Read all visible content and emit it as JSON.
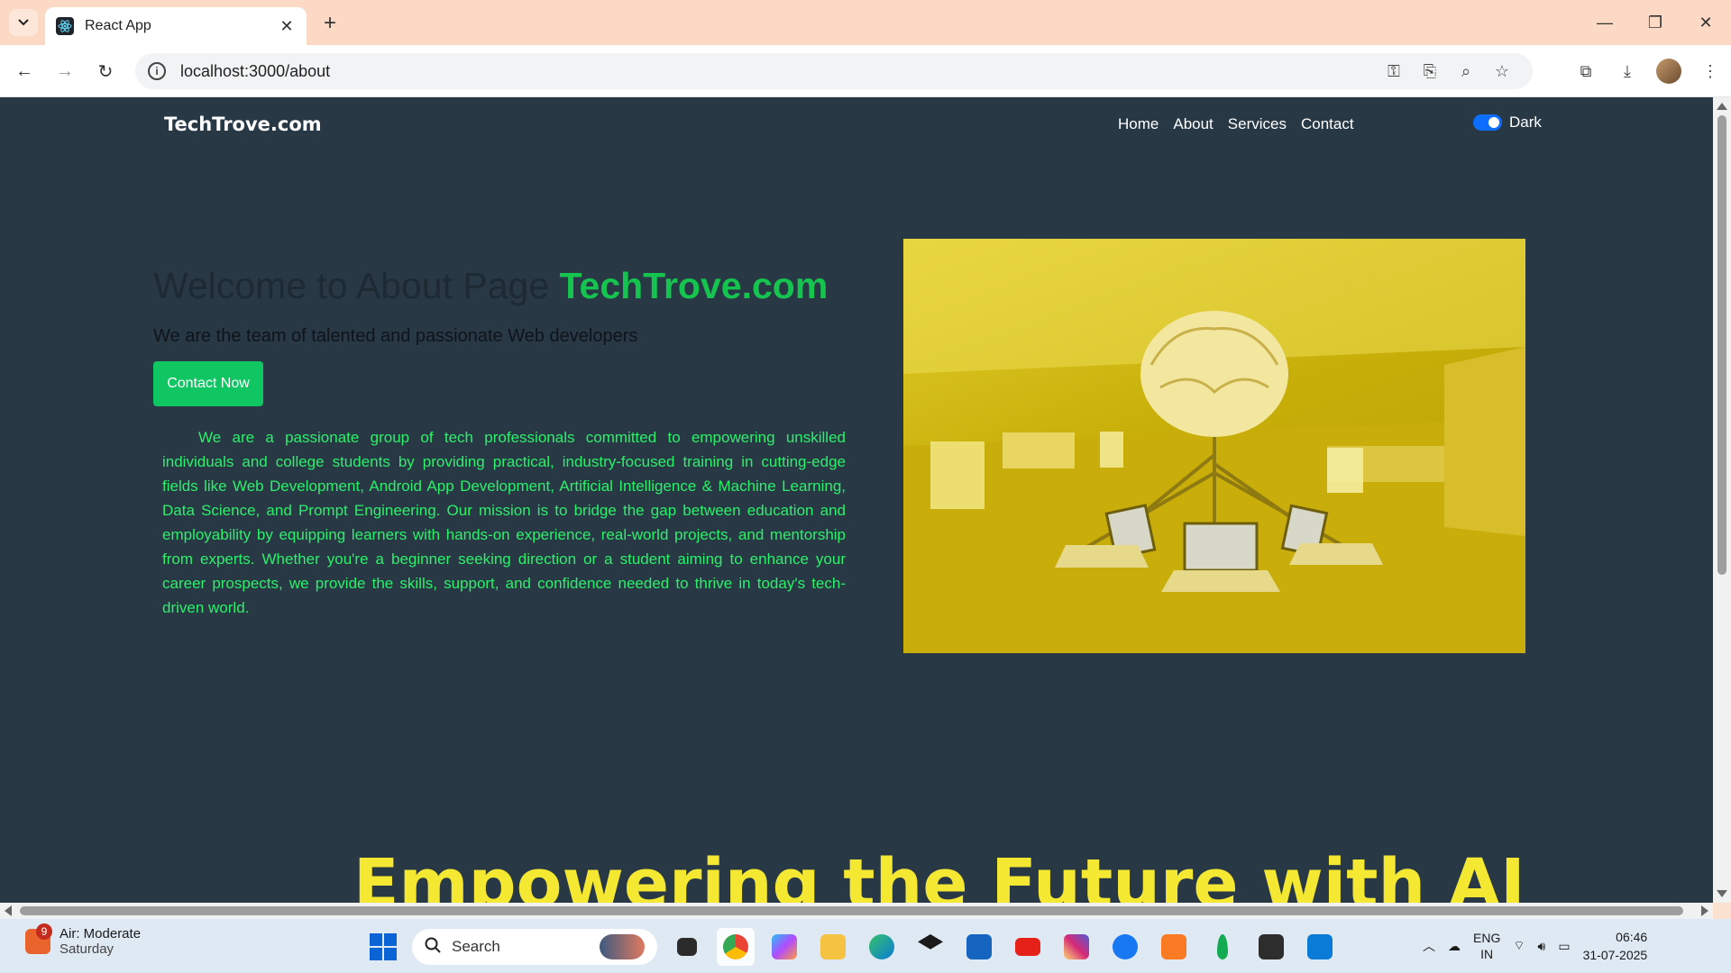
{
  "browser": {
    "tab_title": "React App",
    "url": "localhost:3000/about"
  },
  "navbar": {
    "brand": "TechTrove.com",
    "links": [
      "Home",
      "About",
      "Services",
      "Contact"
    ],
    "theme_label": "Dark"
  },
  "hero": {
    "title_prefix": "Welcome to About Page",
    "title_brand": "TechTrove.com",
    "subtitle": "We are the team of talented and passionate Web developers",
    "button": "Contact Now",
    "paragraph": "We are a passionate group of tech professionals committed to empowering unskilled individuals and college students by providing practical, industry-focused training in cutting-edge fields like Web Development, Android App Development, Artificial Intelligence & Machine Learning, Data Science, and Prompt Engineering. Our mission is to bridge the gap between education and employability by equipping learners with hands-on experience, real-world projects, and mentorship from experts. Whether you're a beginner seeking direction or a student aiming to enhance your career prospects, we provide the skills, support, and confidence needed to thrive in today's tech-driven world."
  },
  "section2": {
    "heading": "Empowering the Future with AI"
  },
  "taskbar": {
    "weather_title": "Air: Moderate",
    "weather_sub": "Saturday",
    "weather_badge": "9",
    "search_placeholder": "Search",
    "lang_top": "ENG",
    "lang_bottom": "IN",
    "time": "06:46",
    "date": "31-07-2025"
  },
  "colors": {
    "page_bg": "#283845",
    "brand_green": "#14c44f",
    "button_green": "#10c663",
    "text_green": "#2cf06a",
    "heading_yellow": "#f5e833",
    "toggle_blue": "#0d6efd"
  }
}
